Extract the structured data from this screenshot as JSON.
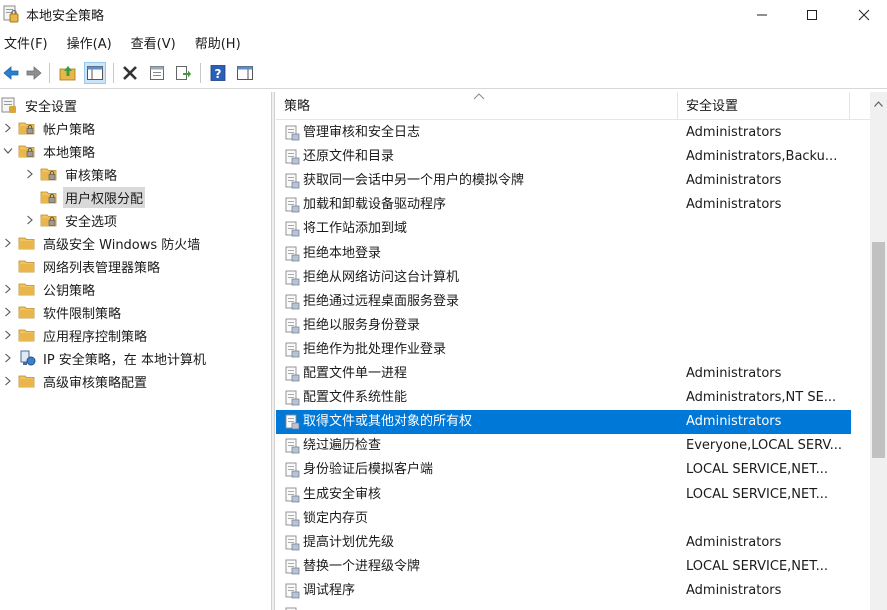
{
  "window": {
    "title": "本地安全策略"
  },
  "menu": [
    {
      "label": "文件(F)"
    },
    {
      "label": "操作(A)"
    },
    {
      "label": "查看(V)"
    },
    {
      "label": "帮助(H)"
    }
  ],
  "toolbar": {
    "buttons": [
      "back-icon",
      "forward-icon",
      "up-folder-icon",
      "show-tree-icon",
      "delete-icon",
      "properties-icon",
      "export-icon",
      "help-icon",
      "show-pane-icon"
    ],
    "active": "show-tree-icon"
  },
  "tree": [
    {
      "label": "安全设置",
      "level": 0,
      "arrow": "none",
      "icon": "security-root-icon"
    },
    {
      "label": "帐户策略",
      "level": 1,
      "arrow": "collapsed",
      "icon": "folder-icon"
    },
    {
      "label": "本地策略",
      "level": 1,
      "arrow": "expanded",
      "icon": "folder-icon"
    },
    {
      "label": "审核策略",
      "level": 2,
      "arrow": "collapsed",
      "icon": "folder-icon"
    },
    {
      "label": "用户权限分配",
      "level": 2,
      "arrow": "none",
      "icon": "folder-icon",
      "selected": true
    },
    {
      "label": "安全选项",
      "level": 2,
      "arrow": "collapsed",
      "icon": "folder-icon"
    },
    {
      "label": "高级安全 Windows 防火墙",
      "level": 1,
      "arrow": "collapsed",
      "icon": "folder-icon"
    },
    {
      "label": "网络列表管理器策略",
      "level": 1,
      "arrow": "none",
      "icon": "folder-icon"
    },
    {
      "label": "公钥策略",
      "level": 1,
      "arrow": "collapsed",
      "icon": "folder-icon"
    },
    {
      "label": "软件限制策略",
      "level": 1,
      "arrow": "collapsed",
      "icon": "folder-icon"
    },
    {
      "label": "应用程序控制策略",
      "level": 1,
      "arrow": "collapsed",
      "icon": "folder-icon"
    },
    {
      "label": "IP 安全策略，在 本地计算机",
      "level": 1,
      "arrow": "collapsed",
      "icon": "ip-security-icon"
    },
    {
      "label": "高级审核策略配置",
      "level": 1,
      "arrow": "collapsed",
      "icon": "folder-icon"
    }
  ],
  "list": {
    "columns": {
      "policy": "策略",
      "setting": "安全设置"
    },
    "rows": [
      {
        "name": "管理审核和安全日志",
        "setting": "Administrators"
      },
      {
        "name": "还原文件和目录",
        "setting": "Administrators,Backu..."
      },
      {
        "name": "获取同一会话中另一个用户的模拟令牌",
        "setting": "Administrators"
      },
      {
        "name": "加载和卸载设备驱动程序",
        "setting": "Administrators"
      },
      {
        "name": "将工作站添加到域",
        "setting": ""
      },
      {
        "name": "拒绝本地登录",
        "setting": ""
      },
      {
        "name": "拒绝从网络访问这台计算机",
        "setting": ""
      },
      {
        "name": "拒绝通过远程桌面服务登录",
        "setting": ""
      },
      {
        "name": "拒绝以服务身份登录",
        "setting": ""
      },
      {
        "name": "拒绝作为批处理作业登录",
        "setting": ""
      },
      {
        "name": "配置文件单一进程",
        "setting": "Administrators"
      },
      {
        "name": "配置文件系统性能",
        "setting": "Administrators,NT SE..."
      },
      {
        "name": "取得文件或其他对象的所有权",
        "setting": "Administrators",
        "selected": true
      },
      {
        "name": "绕过遍历检查",
        "setting": "Everyone,LOCAL SERV..."
      },
      {
        "name": "身份验证后模拟客户端",
        "setting": "LOCAL SERVICE,NET..."
      },
      {
        "name": "生成安全审核",
        "setting": "LOCAL SERVICE,NET..."
      },
      {
        "name": "锁定内存页",
        "setting": ""
      },
      {
        "name": "提高计划优先级",
        "setting": "Administrators"
      },
      {
        "name": "替换一个进程级令牌",
        "setting": "LOCAL SERVICE,NET..."
      },
      {
        "name": "调试程序",
        "setting": "Administrators"
      },
      {
        "name": "",
        "setting": ""
      }
    ]
  },
  "colors": {
    "selection": "#0078d7",
    "folder": "#e8b64a",
    "tree_selected": "#d9d9d9"
  }
}
